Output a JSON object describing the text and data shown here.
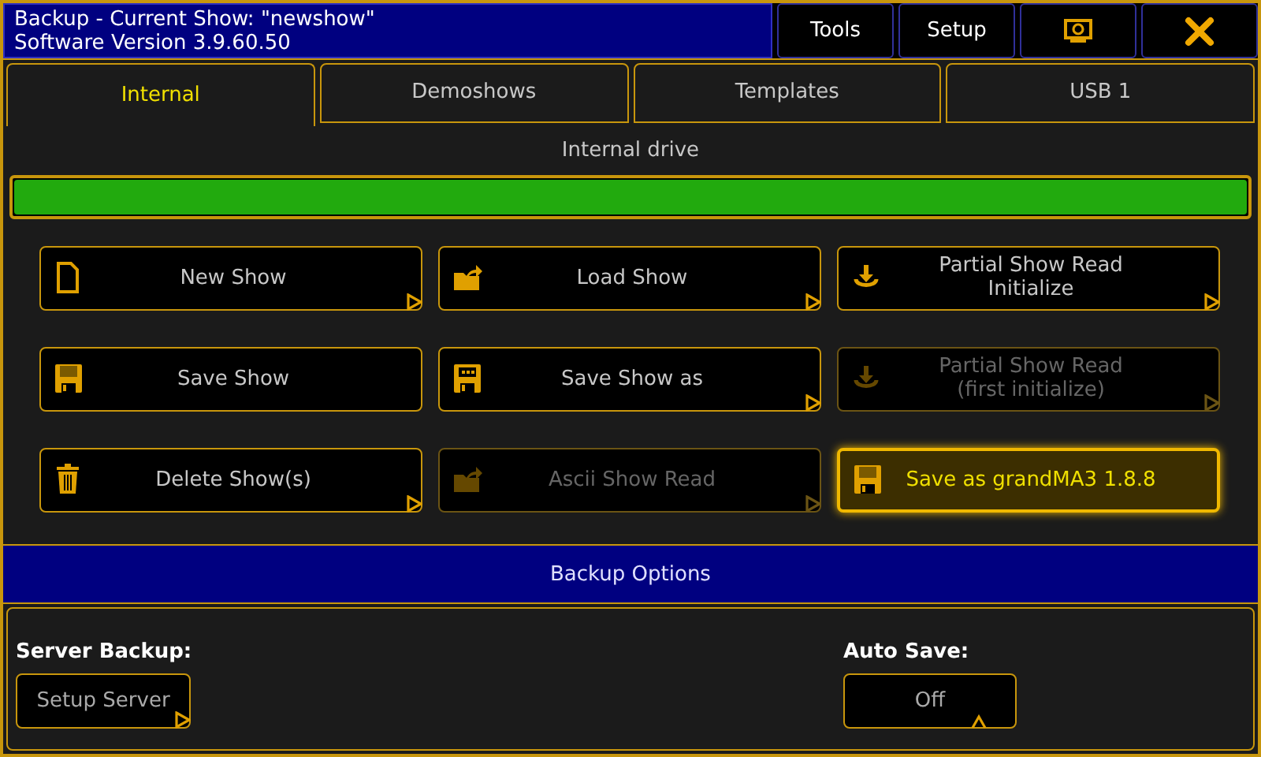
{
  "header": {
    "title": "Backup - Current Show:  \"newshow\"",
    "subtitle": "Software Version 3.9.60.50",
    "buttons": [
      {
        "kind": "text",
        "label": "Tools"
      },
      {
        "kind": "text",
        "label": "Setup"
      },
      {
        "kind": "screen"
      },
      {
        "kind": "close"
      }
    ]
  },
  "tabs": [
    {
      "label": "Internal",
      "selected": true
    },
    {
      "label": "Demoshows",
      "selected": false
    },
    {
      "label": "Templates",
      "selected": false
    },
    {
      "label": "USB 1",
      "selected": false
    }
  ],
  "drive": {
    "label": "Internal drive",
    "level": 1
  },
  "actions": [
    {
      "kind": "file",
      "lines": [
        "New Show"
      ],
      "disabled": false,
      "highlighted": false,
      "arrow": true
    },
    {
      "kind": "folder",
      "lines": [
        "Load Show"
      ],
      "disabled": false,
      "highlighted": false,
      "arrow": true
    },
    {
      "kind": "download",
      "lines": [
        "Partial Show Read",
        "Initialize"
      ],
      "disabled": false,
      "highlighted": false,
      "arrow": true
    },
    {
      "kind": "floppy",
      "lines": [
        "Save Show"
      ],
      "disabled": false,
      "highlighted": false,
      "arrow": false
    },
    {
      "kind": "floppydots",
      "lines": [
        "Save Show as"
      ],
      "disabled": false,
      "highlighted": false,
      "arrow": true
    },
    {
      "kind": "download",
      "lines": [
        "Partial Show Read",
        "(first initialize)"
      ],
      "disabled": true,
      "highlighted": false,
      "arrow": true
    },
    {
      "kind": "trash",
      "lines": [
        "Delete Show(s)"
      ],
      "disabled": false,
      "highlighted": false,
      "arrow": true
    },
    {
      "kind": "folder",
      "lines": [
        "Ascii Show Read"
      ],
      "disabled": true,
      "highlighted": false,
      "arrow": true
    },
    {
      "kind": "floppy",
      "lines": [
        "Save as grandMA3 1.8.8"
      ],
      "disabled": false,
      "highlighted": true,
      "arrow": false
    }
  ],
  "options": {
    "title": "Backup Options",
    "groups": [
      {
        "label": "Server Backup:",
        "button": "Setup Server",
        "kind": "arrow"
      },
      {
        "label": "Auto Save:",
        "button": "Off",
        "kind": "notch"
      }
    ]
  }
}
